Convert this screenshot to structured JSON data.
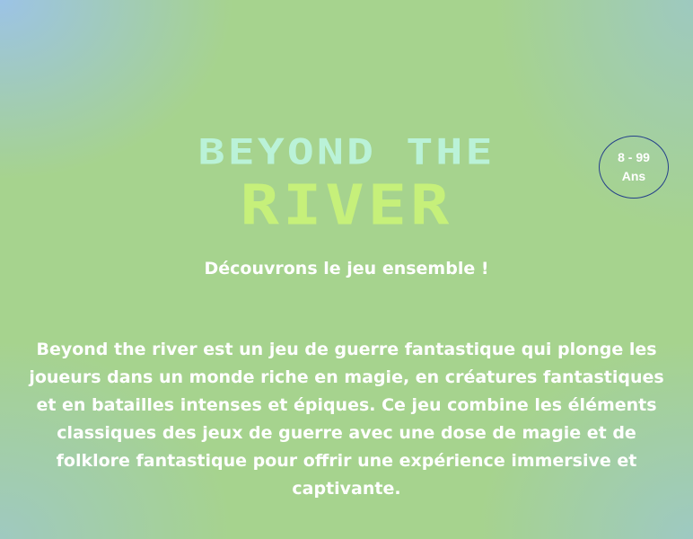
{
  "hero": {
    "title_line1": "BEYOND THE",
    "title_line2": "RIVER",
    "subtitle": "Découvrons le jeu ensemble !",
    "description": "Beyond the river est un jeu de guerre fantastique qui plonge les joueurs dans un monde riche en magie, en créatures fantastiques et en batailles intenses et épiques. Ce jeu combine les éléments classiques des jeux de guerre avec une dose de magie et de folklore fantastique pour offrir une expérience immersive et captivante."
  },
  "age_badge": {
    "range": "8 - 99",
    "unit": "Ans"
  },
  "colors": {
    "title_line1": "#baf2d8",
    "title_line2": "#c6f07a",
    "badge_border": "#25408a",
    "text": "#ffffff"
  }
}
